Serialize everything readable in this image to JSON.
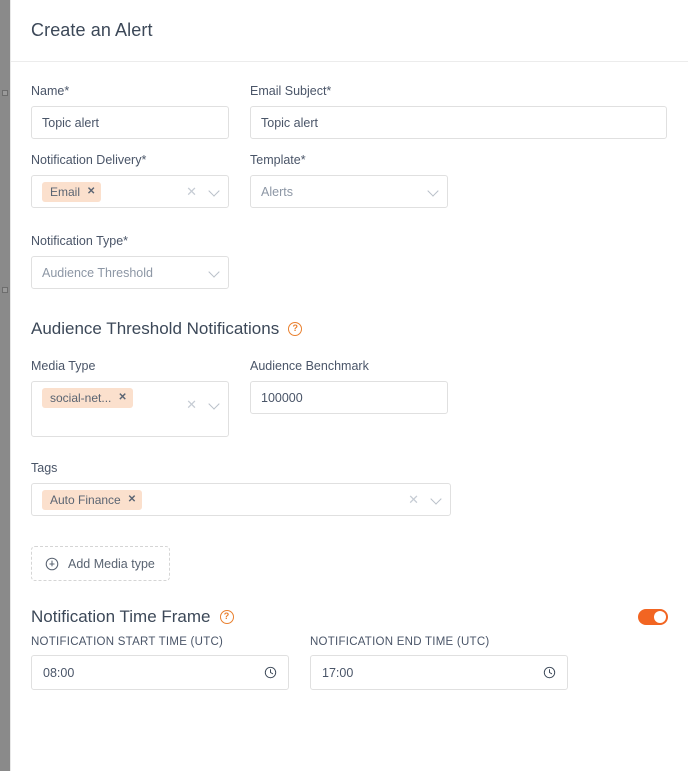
{
  "modal": {
    "title": "Create an Alert"
  },
  "form": {
    "name": {
      "label": "Name*",
      "value": "Topic alert"
    },
    "email_subject": {
      "label": "Email Subject*",
      "value": "Topic alert"
    },
    "notification_delivery": {
      "label": "Notification Delivery*",
      "chips": [
        "Email"
      ],
      "chip_remove": "✕",
      "clear_icon": "✕",
      "caret_icon": "chevron-down-icon"
    },
    "template": {
      "label": "Template*",
      "value": "Alerts",
      "caret_icon": "chevron-down-icon"
    },
    "notification_type": {
      "label": "Notification Type*",
      "value": "Audience Threshold",
      "caret_icon": "chevron-down-icon"
    }
  },
  "audience_section": {
    "title": "Audience Threshold Notifications",
    "help_icon": "?",
    "media_type": {
      "label": "Media Type",
      "chips": [
        "social-net..."
      ],
      "chip_remove": "✕",
      "clear_icon": "✕"
    },
    "audience_benchmark": {
      "label": "Audience Benchmark",
      "value": "100000"
    },
    "tags": {
      "label": "Tags",
      "chips": [
        "Auto Finance"
      ],
      "chip_remove": "✕",
      "clear_icon": "✕"
    },
    "add_media_type_button": {
      "label": "Add Media type",
      "icon": "plus-circle-icon"
    }
  },
  "timeframe_section": {
    "title": "Notification Time Frame",
    "help_icon": "?",
    "toggle_state": "on",
    "start": {
      "label": "NOTIFICATION START TIME (UTC)",
      "value": "08:00",
      "icon": "clock-icon"
    },
    "end": {
      "label": "NOTIFICATION END TIME (UTC)",
      "value": "17:00",
      "icon": "clock-icon"
    }
  },
  "colors": {
    "accent": "#f26522",
    "chip_bg": "#fbe0cd",
    "text": "#4a5568",
    "border": "#e0e0e0"
  }
}
